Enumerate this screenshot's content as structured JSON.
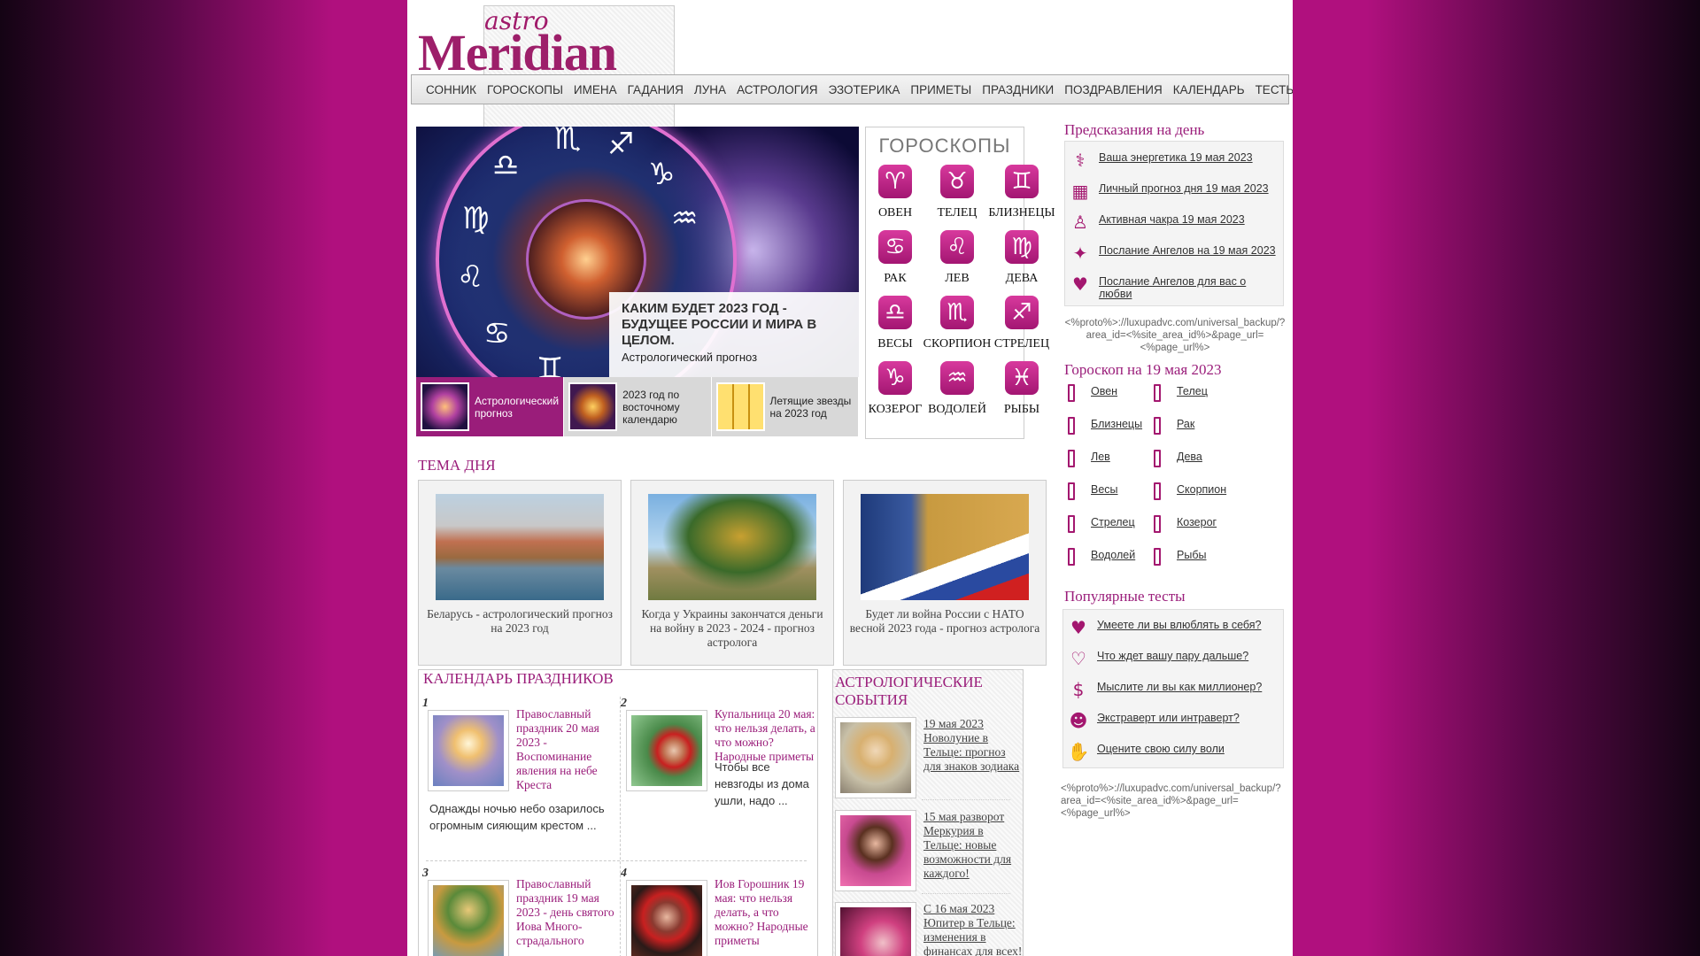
{
  "logo": {
    "astro": "astro",
    "meridian": "Meridian"
  },
  "nav": [
    "СОННИК",
    "ГОРОСКОПЫ",
    "ИМЕНА",
    "ГАДАНИЯ",
    "ЛУНА",
    "АСТРОЛОГИЯ",
    "ЭЗОТЕРИКА",
    "ПРИМЕТЫ",
    "ПРАЗДНИКИ",
    "ПОЗДРАВЛЕНИЯ",
    "КАЛЕНДАРЬ",
    "ТЕСТЫ"
  ],
  "hero": {
    "title": "КАКИМ БУДЕТ 2023 ГОД - БУДУЩЕЕ РОССИИ И МИРА В ЦЕЛОМ.",
    "subtitle": "Астрологический прогноз",
    "tabs": [
      "Астрологический прогноз",
      "2023 год по восточному календарю",
      "Летящие звезды на 2023 год"
    ]
  },
  "horoscopes": {
    "title": "ГОРОСКОПЫ",
    "signs": [
      {
        "name": "ОВЕН",
        "glyph": "♈"
      },
      {
        "name": "ТЕЛЕЦ",
        "glyph": "♉"
      },
      {
        "name": "БЛИЗНЕЦЫ",
        "glyph": "♊"
      },
      {
        "name": "РАК",
        "glyph": "♋"
      },
      {
        "name": "ЛЕВ",
        "glyph": "♌"
      },
      {
        "name": "ДЕВА",
        "glyph": "♍"
      },
      {
        "name": "ВЕСЫ",
        "glyph": "♎"
      },
      {
        "name": "СКОРПИОН",
        "glyph": "♏"
      },
      {
        "name": "СТРЕЛЕЦ",
        "glyph": "♐"
      },
      {
        "name": "КОЗЕРОГ",
        "glyph": "♑"
      },
      {
        "name": "ВОДОЛЕЙ",
        "glyph": "♒"
      },
      {
        "name": "РЫБЫ",
        "glyph": "♓"
      }
    ]
  },
  "predictions": {
    "title": "Предсказания на день",
    "items": [
      {
        "icon": "energy-icon",
        "glyph": "⚕",
        "label": "Ваша энергетика 19 мая 2023"
      },
      {
        "icon": "calendar-icon",
        "glyph": "▦",
        "label": "Личный прогноз дня 19 мая 2023"
      },
      {
        "icon": "chakra-icon",
        "glyph": "♙",
        "label": "Активная чакра 19 мая 2023"
      },
      {
        "icon": "wand-icon",
        "glyph": "✦",
        "label": "Послание Ангелов на 19 мая 2023"
      },
      {
        "icon": "heart-icon",
        "glyph": "♥",
        "label": "Послание Ангелов для вас о любви"
      }
    ]
  },
  "ad_code": "<%proto%>://luxupadvc.com/universal_backup/?area_id=<%site_area_id%>&page_url=<%page_url%>",
  "daily": {
    "title": "Гороскоп на 19 мая 2023",
    "items": [
      "Овен",
      "Телец",
      "Близнецы",
      "Рак",
      "Лев",
      "Дева",
      "Весы",
      "Скорпион",
      "Стрелец",
      "Козерог",
      "Водолей",
      "Рыбы"
    ]
  },
  "tema": {
    "title": "ТЕМА ДНЯ",
    "cards": [
      "Беларусь - астрологический прогноз на 2023 год",
      "Когда у Украины закончатся деньги на войну в 2023 - 2024 - прогноз астролога",
      "Будет ли война России с НАТО весной 2023 года - прогноз астролога"
    ]
  },
  "calendar": {
    "title": "КАЛЕНДАРЬ ПРАЗДНИКОВ",
    "items": [
      {
        "num": "1",
        "link": "Православный праздник 20 мая 2023 - Воспоминание явления на небе Креста",
        "desc": "Однажды ночью небо озарилось огромным сияющим крестом ..."
      },
      {
        "num": "2",
        "link": "Купальница 20 мая: что нельзя делать, а что можно? Народные приметы",
        "desc": "Чтобы все невзгоды из дома ушли, надо ..."
      },
      {
        "num": "3",
        "link": "Православный праздник 19 мая 2023 - день святого Иова Много-страдального",
        "desc": ""
      },
      {
        "num": "4",
        "link": "Иов Горошник 19 мая: что нельзя делать, а что можно? Народные приметы",
        "desc": ""
      }
    ]
  },
  "astro_events": {
    "title": "АСТРОЛОГИЧЕСКИЕ СОБЫТИЯ",
    "items": [
      "19 мая 2023 Новолуние в Тельце: прогноз для знаков зодиака",
      "15 мая разворот Меркурия в Тельце: новые возможности для каждого!",
      "С 16 мая 2023 Юпитер в Тельце: изменения в финансах для всех!"
    ]
  },
  "tests": {
    "title": "Популярные тесты",
    "items": [
      {
        "icon": "heart-icon",
        "glyph": "♥",
        "label": "Умеете ли вы влюблять в себя?"
      },
      {
        "icon": "heartbeat-icon",
        "glyph": "♡",
        "label": "Что ждет вашу пару дальше?"
      },
      {
        "icon": "money-icon",
        "glyph": "$",
        "label": "Мыслите ли вы как миллионер?"
      },
      {
        "icon": "people-icon",
        "glyph": "☻",
        "label": "Экстраверт или интраверт?"
      },
      {
        "icon": "hand-icon",
        "glyph": "✋",
        "label": "Оцените свою силу воли"
      }
    ]
  },
  "colors": {
    "accent": "#9a1d7a",
    "icon": "#a3176f",
    "background": "#b0107e"
  }
}
